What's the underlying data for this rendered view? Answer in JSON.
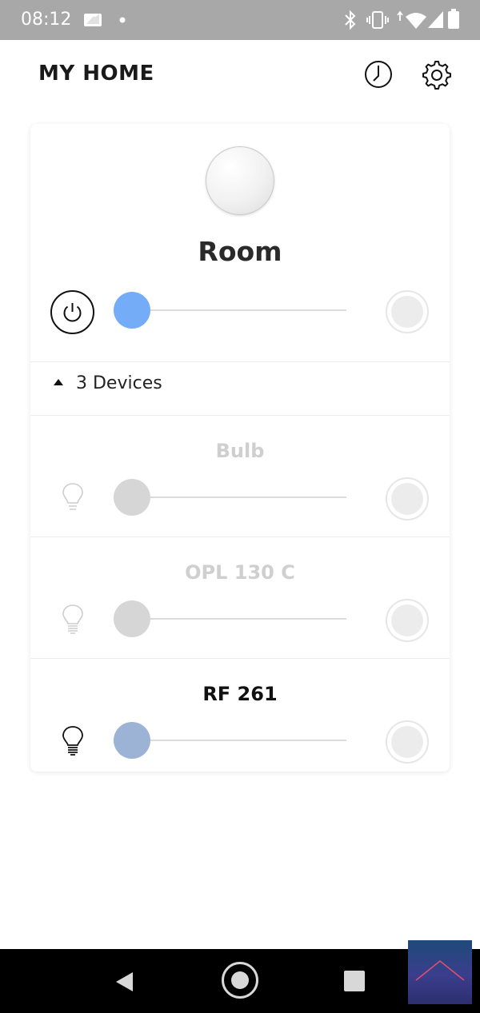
{
  "status_bar": {
    "time": "08:12",
    "icons": [
      "sim-card-icon",
      "notification-dot-icon",
      "bluetooth-icon",
      "vibrate-icon",
      "wifi-icon",
      "signal-icon",
      "battery-icon"
    ]
  },
  "header": {
    "title": "MY HOME",
    "icons": [
      "clock-icon",
      "gear-icon"
    ]
  },
  "room": {
    "name": "Room",
    "slider_color": "#74acf7",
    "brightness": 0
  },
  "devices": {
    "toggle_label": "3 Devices",
    "items": [
      {
        "name": "Bulb",
        "enabled": false,
        "slider_color": "#d6d6d6",
        "brightness": 0
      },
      {
        "name": "OPL 130 C",
        "enabled": false,
        "slider_color": "#d6d6d6",
        "brightness": 0
      },
      {
        "name": "RF 261",
        "enabled": true,
        "slider_color": "#9cb3d6",
        "brightness": 0
      }
    ]
  },
  "nav": {
    "icons": [
      "back-icon",
      "home-icon",
      "recents-icon"
    ]
  }
}
